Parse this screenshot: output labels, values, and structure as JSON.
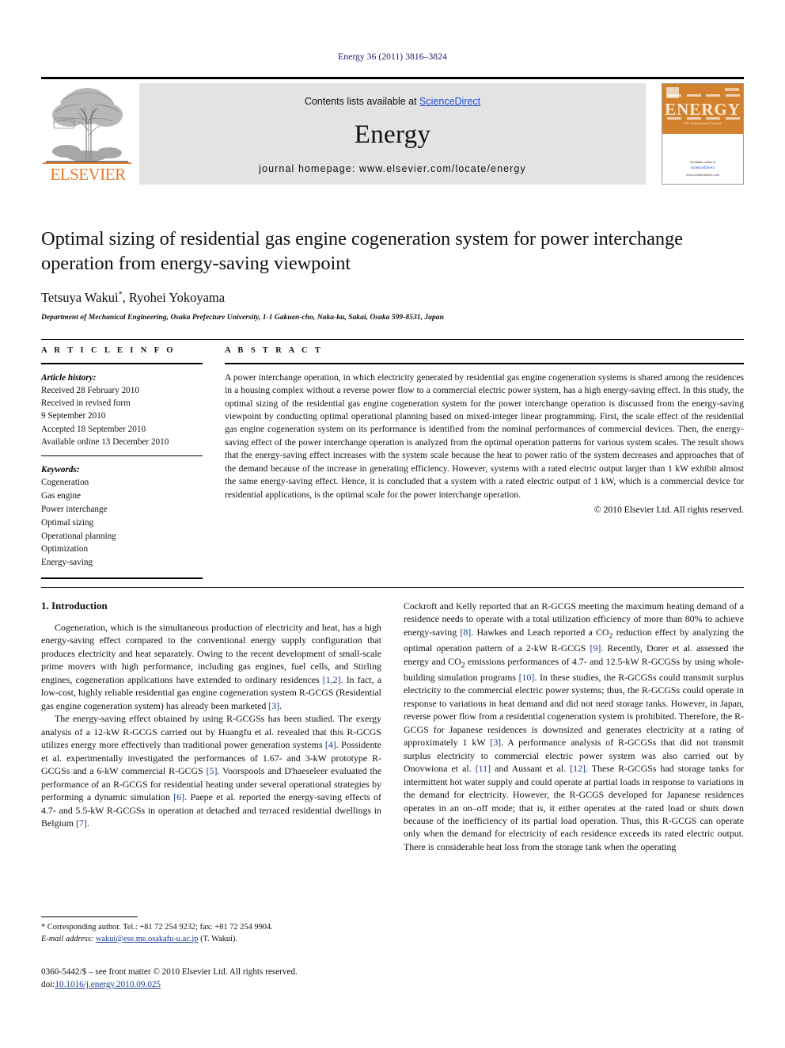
{
  "running_head": "Energy 36 (2011) 3816–3824",
  "masthead": {
    "contents_prefix": "Contents lists available at ",
    "sciencedirect": "ScienceDirect",
    "journal_title": "Energy",
    "homepage": "journal homepage: www.elsevier.com/locate/energy",
    "publisher_logo_text": "ELSEVIER",
    "publisher_logo_icon": "elsevier-tree-icon",
    "cover": {
      "title": "ENERGY",
      "subtitle": "The International Journal",
      "footer_line1": "Available online at",
      "footer_badge": "ScienceDirect",
      "footer_line2": "www.sciencedirect.com"
    }
  },
  "article": {
    "title": "Optimal sizing of residential gas engine cogeneration system for power interchange operation from energy-saving viewpoint",
    "authors": "Tetsuya Wakui",
    "authors_mark": "*",
    "authors_rest": ", Ryohei Yokoyama",
    "affiliation": "Department of Mechanical Engineering, Osaka Prefecture University, 1-1 Gakuen-cho, Naka-ku, Sakai, Osaka 599-8531, Japan"
  },
  "article_info": {
    "heading": "A R T I C L E   I N F O",
    "history_label": "Article history:",
    "history": [
      "Received 28 February 2010",
      "Received in revised form",
      "9 September 2010",
      "Accepted 18 September 2010",
      "Available online 13 December 2010"
    ],
    "keywords_label": "Keywords:",
    "keywords": [
      "Cogeneration",
      "Gas engine",
      "Power interchange",
      "Optimal sizing",
      "Operational planning",
      "Optimization",
      "Energy-saving"
    ]
  },
  "abstract": {
    "heading": "A B S T R A C T",
    "text": "A power interchange operation, in which electricity generated by residential gas engine cogeneration systems is shared among the residences in a housing complex without a reverse power flow to a commercial electric power system, has a high energy-saving effect. In this study, the optimal sizing of the residential gas engine cogeneration system for the power interchange operation is discussed from the energy-saving viewpoint by conducting optimal operational planning based on mixed-integer linear programming. First, the scale effect of the residential gas engine cogeneration system on its performance is identified from the nominal performances of commercial devices. Then, the energy-saving effect of the power interchange operation is analyzed from the optimal operation patterns for various system scales. The result shows that the energy-saving effect increases with the system scale because the heat to power ratio of the system decreases and approaches that of the demand because of the increase in generating efficiency. However, systems with a rated electric output larger than 1 kW exhibit almost the same energy-saving effect. Hence, it is concluded that a system with a rated electric output of 1 kW, which is a commercial device for residential applications, is the optimal scale for the power interchange operation.",
    "copyright": "© 2010 Elsevier Ltd. All rights reserved."
  },
  "body": {
    "section_number_title": "1. Introduction",
    "left_paragraphs": [
      "Cogeneration, which is the simultaneous production of electricity and heat, has a high energy-saving effect compared to the conventional energy supply configuration that produces electricity and heat separately. Owing to the recent development of small-scale prime movers with high performance, including gas engines, fuel cells, and Stirling engines, cogeneration applications have extended to ordinary residences [1,2]. In fact, a low-cost, highly reliable residential gas engine cogeneration system R-GCGS (Residential gas engine cogeneration system) has already been marketed [3].",
      "The energy-saving effect obtained by using R-GCGSs has been studied. The exergy analysis of a 12-kW R-GCGS carried out by Huangfu et al. revealed that this R-GCGS utilizes energy more effectively than traditional power generation systems [4]. Possidente et al. experimentally investigated the performances of 1.67- and 3-kW prototype R-GCGSs and a 6-kW commercial R-GCGS [5]. Voorspools and D'haeseleer evaluated the performance of an R-GCGS for residential heating under several operational strategies by performing a dynamic simulation [6]. Paepe et al. reported the energy-saving effects of 4.7- and 5.5-kW R-GCGSs in operation at detached and terraced residential dwellings in Belgium [7]."
    ],
    "right_paragraphs": [
      "Cockroft and Kelly reported that an R-GCGS meeting the maximum heating demand of a residence needs to operate with a total utilization efficiency of more than 80% to achieve energy-saving [8]. Hawkes and Leach reported a CO2 reduction effect by analyzing the optimal operation pattern of a 2-kW R-GCGS [9]. Recently, Dorer et al. assessed the energy and CO2 emissions performances of 4.7- and 12.5-kW R-GCGSs by using whole-building simulation programs [10]. In these studies, the R-GCGSs could transmit surplus electricity to the commercial electric power systems; thus, the R-GCGSs could operate in response to variations in heat demand and did not need storage tanks. However, in Japan, reverse power flow from a residential cogeneration system is prohibited. Therefore, the R-GCGS for Japanese residences is downsized and generates electricity at a rating of approximately 1 kW [3]. A performance analysis of R-GCGSs that did not transmit surplus electricity to commercial electric power system was also carried out by Onovwiona et al. [11] and Aussant et al. [12]. These R-GCGSs had storage tanks for intermittent hot water supply and could operate at partial loads in response to variations in the demand for electricity. However, the R-GCGS developed for Japanese residences operates in an on–off mode; that is, it either operates at the rated load or shuts down because of the inefficiency of its partial load operation. Thus, this R-GCGS can operate only when the demand for electricity of each residence exceeds its rated electric output. There is considerable heat loss from the storage tank when the operating"
    ]
  },
  "footnote": {
    "corresponding": "* Corresponding author. Tel.: +81 72 254 9232; fax: +81 72 254 9904.",
    "email_label": "E-mail address:",
    "email": "wakui@ese.me.osakafu-u.ac.jp",
    "email_suffix": " (T. Wakui)."
  },
  "imprint": {
    "line1": "0360-5442/$ – see front matter © 2010 Elsevier Ltd. All rights reserved.",
    "doi_label": "doi:",
    "doi": "10.1016/j.energy.2010.09.025"
  },
  "colors": {
    "link": "#1a3a8f",
    "sciencedirect": "#1e4fd8",
    "elsevier_orange": "#E8792A",
    "cover_orange": "#D2822E",
    "running_head": "#1a1a6e"
  }
}
